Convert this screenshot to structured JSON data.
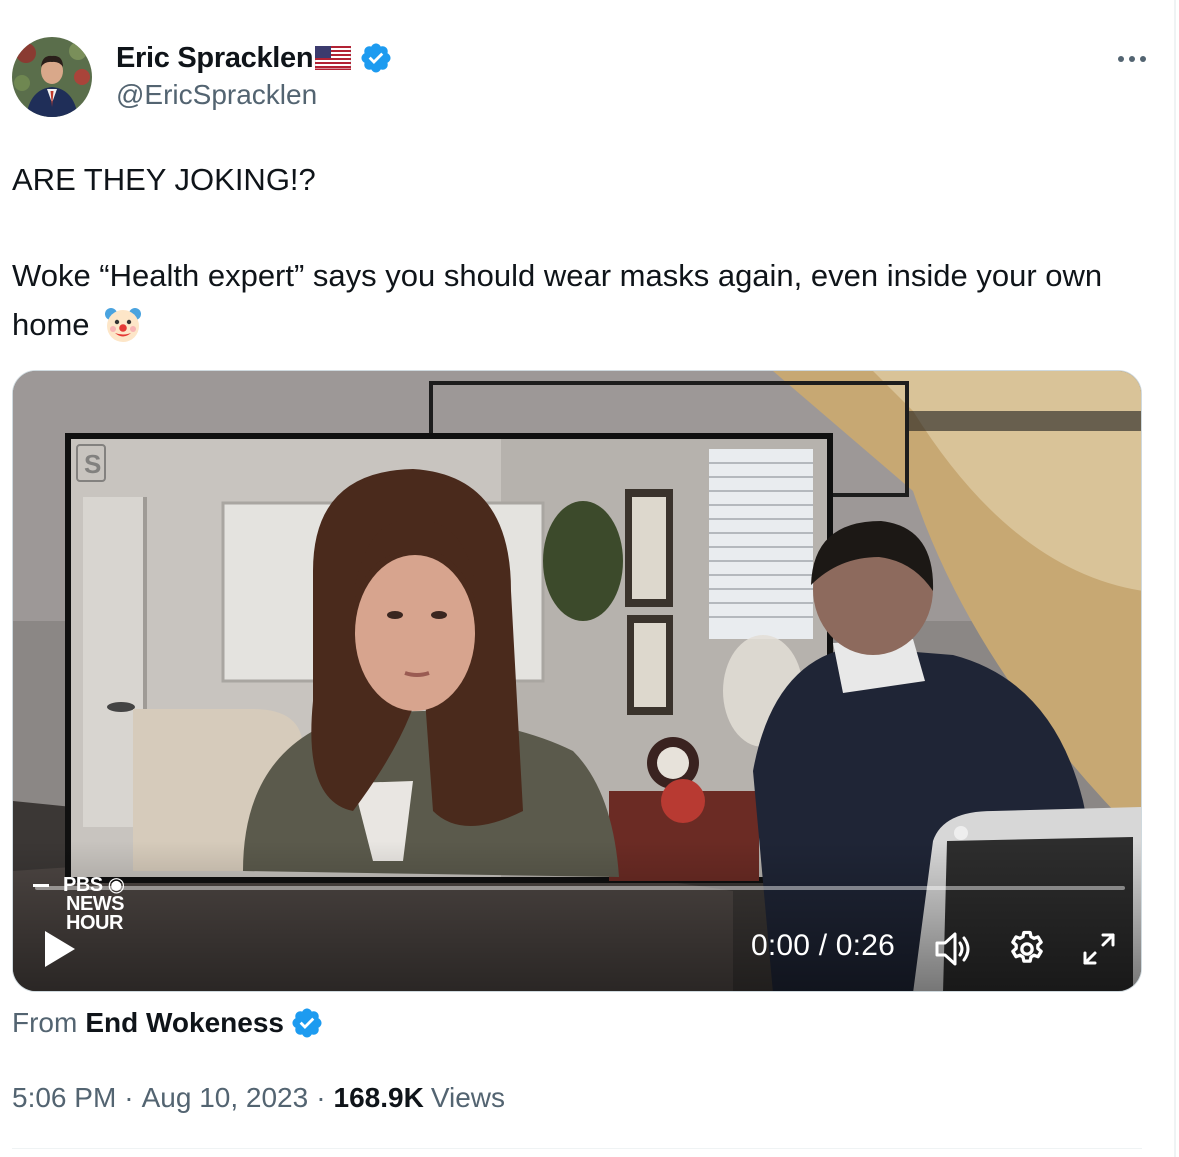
{
  "author": {
    "display_name": "Eric Spracklen",
    "flag_emoji": "🇺🇸",
    "handle": "@EricSpracklen",
    "verified": true
  },
  "tweet": {
    "line1": "ARE THEY JOKING!?",
    "line2": "Woke “Health expert” says you should wear masks again, even inside your own home",
    "emoji": "🤡"
  },
  "video": {
    "time_display": "0:00 / 0:26",
    "progress": 0,
    "watermark": [
      "PBS",
      "NEWS",
      "HOUR"
    ],
    "set_monogram": "S"
  },
  "attribution": {
    "from_label": "From",
    "source_name": "End Wokeness",
    "verified": true
  },
  "meta": {
    "time": "5:06 PM",
    "separator": "·",
    "date": "Aug 10, 2023",
    "views_count": "168.9K",
    "views_label": "Views"
  },
  "icons": {
    "more": "more-horizontal-icon",
    "verified": "verified-badge-icon",
    "play": "play-icon",
    "volume": "volume-icon",
    "settings": "gear-icon",
    "fullscreen": "fullscreen-icon"
  },
  "colors": {
    "verified_blue": "#1d9bf0",
    "text_primary": "#0f1419",
    "text_secondary": "#536471"
  }
}
